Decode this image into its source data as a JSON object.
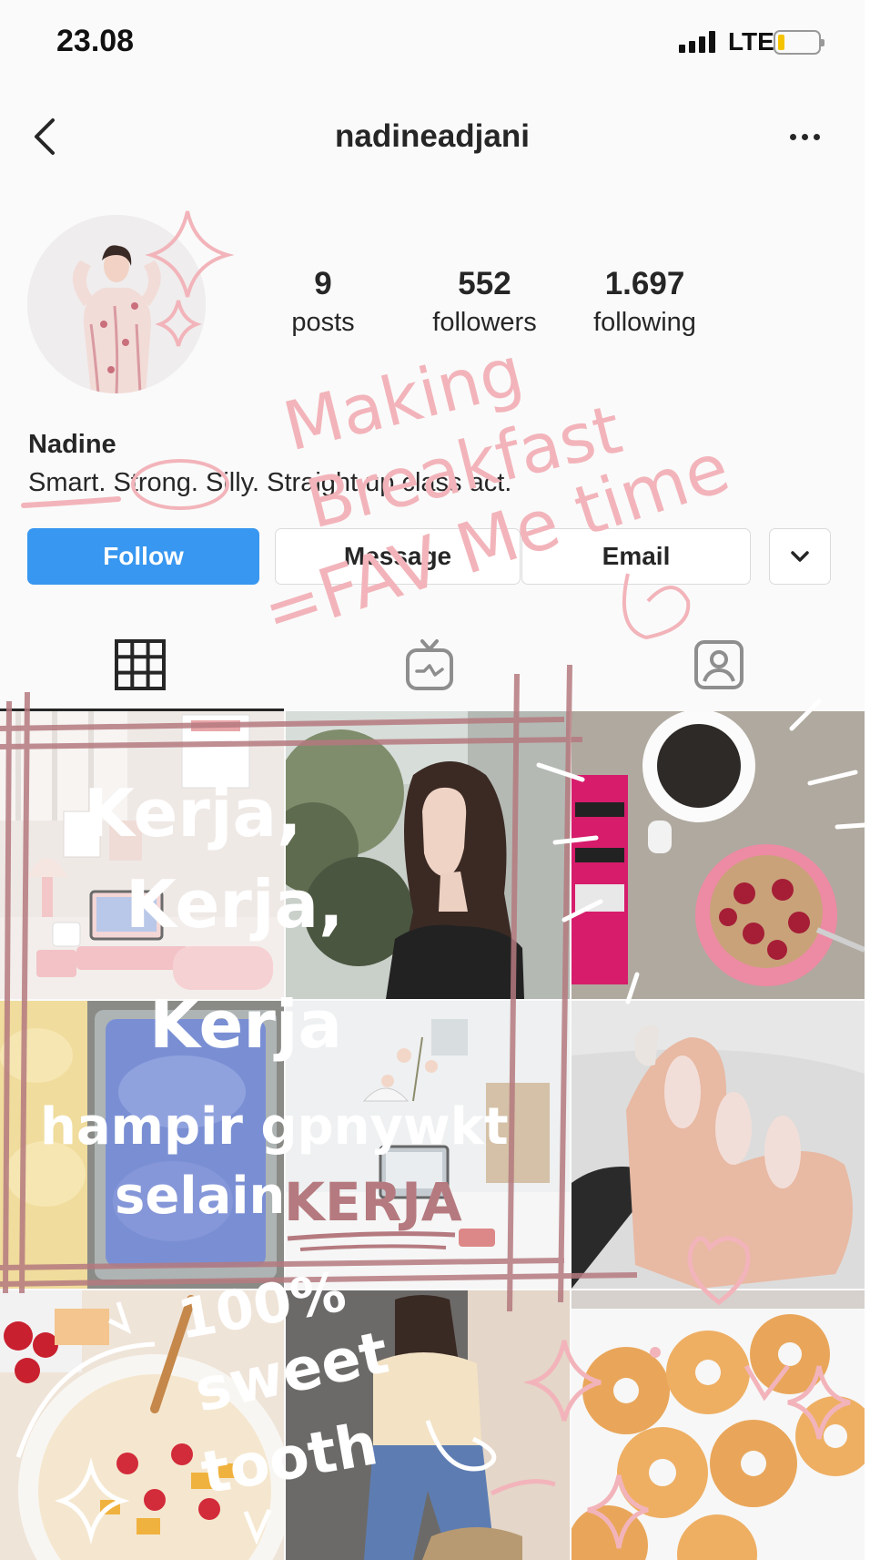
{
  "status_bar": {
    "time": "23.08",
    "network": "LTE",
    "battery_level": 0.15,
    "colors": {
      "battery": "#f5c400"
    }
  },
  "header": {
    "username": "nadineadjani",
    "back_icon": "chevron-left-icon",
    "more_icon": "more-horizontal-icon"
  },
  "profile": {
    "display_name": "Nadine",
    "bio": "Smart. Strong. Silly. Straight up class act.",
    "stats": [
      {
        "value": "9",
        "label": "posts"
      },
      {
        "value": "552",
        "label": "followers"
      },
      {
        "value": "1.697",
        "label": "following"
      }
    ]
  },
  "actions": {
    "follow": "Follow",
    "message": "Message",
    "email": "Email",
    "dropdown_icon": "chevron-down-icon",
    "colors": {
      "follow": "#3897f0"
    }
  },
  "tabs": [
    {
      "icon": "grid-icon",
      "active": true
    },
    {
      "icon": "igtv-icon",
      "active": false
    },
    {
      "icon": "tagged-icon",
      "active": false
    }
  ],
  "posts": [
    {
      "subject": "pink desk setup"
    },
    {
      "subject": "portrait by tree"
    },
    {
      "subject": "coffee, book and berry bowl"
    },
    {
      "subject": "ice cream trays"
    },
    {
      "subject": "white desk with flowers"
    },
    {
      "subject": "manicured hand"
    },
    {
      "subject": "cereal bowl with fruit"
    },
    {
      "subject": "woman in jeans"
    },
    {
      "subject": "glazed donuts"
    }
  ],
  "annotations": {
    "top_pink": [
      "Making",
      "Breakfast",
      "=FAV Me time"
    ],
    "white_left": [
      "Kerja,",
      "Kerja,",
      "Kerja",
      "hampir gpnywkt",
      "selain"
    ],
    "pink_kerja": "KERJA",
    "white_bottom": [
      "100%",
      "sweet",
      "tooth"
    ],
    "colors": {
      "pink": "#f2b4ba",
      "mauve": "#b57a7f",
      "white": "#ffffff"
    }
  }
}
